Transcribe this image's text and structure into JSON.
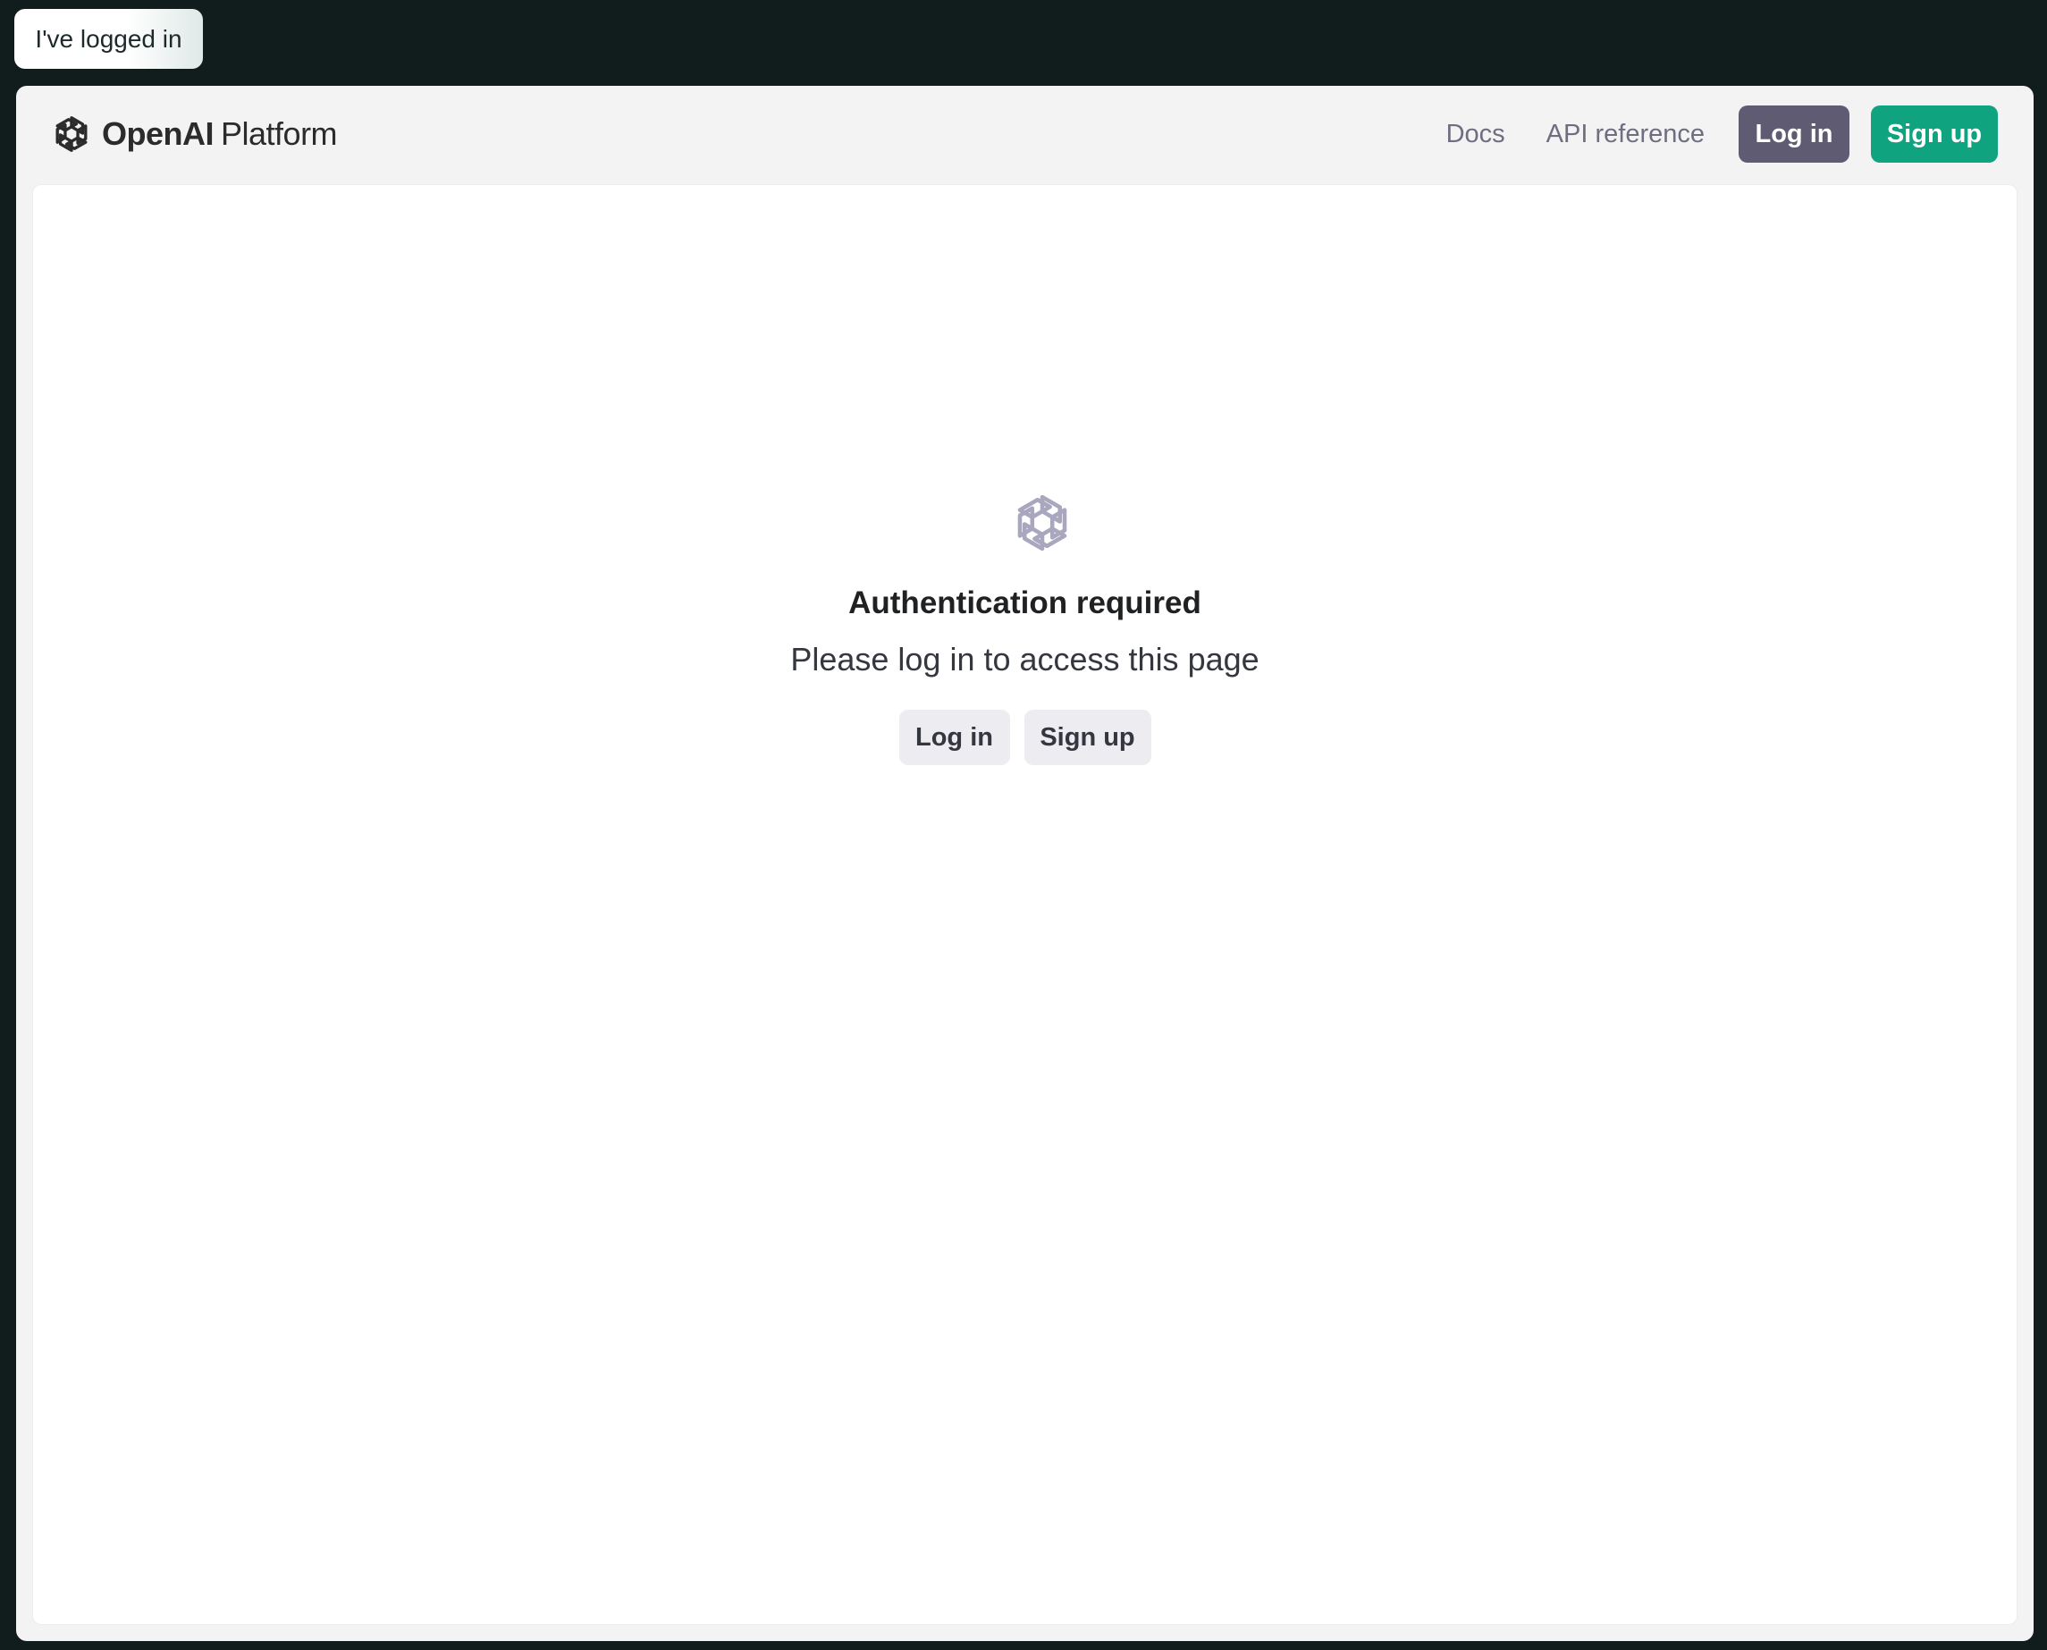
{
  "overlay": {
    "logged_in_label": "I've logged in"
  },
  "header": {
    "brand_name": "OpenAI",
    "brand_suffix": "Platform",
    "links": [
      {
        "label": "Docs"
      },
      {
        "label": "API reference"
      }
    ],
    "login_label": "Log in",
    "signup_label": "Sign up"
  },
  "auth": {
    "title": "Authentication required",
    "subtitle": "Please log in to access this page",
    "login_label": "Log in",
    "signup_label": "Sign up"
  },
  "colors": {
    "background": "#111c1d",
    "login_button": "#5f5b73",
    "signup_button": "#10a37f",
    "secondary_button": "#ececf1",
    "logo_muted": "#a9a7bd"
  },
  "icons": {
    "brand": "openai-logo-icon",
    "auth": "openai-logo-icon"
  }
}
